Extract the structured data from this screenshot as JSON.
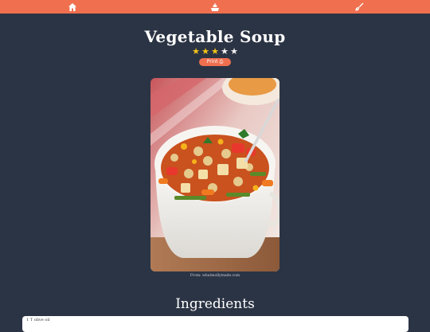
{
  "nav": {
    "items": [
      {
        "icon": "home-icon"
      },
      {
        "icon": "recipes-icon"
      },
      {
        "icon": "whisk-icon"
      }
    ],
    "accent": "#ef6f4f"
  },
  "recipe": {
    "title": "Vegetable Soup",
    "rating": 3,
    "rating_max": 5,
    "star_glyph": "★",
    "print_label": "Print ⎙",
    "image_credit": "From: whatmollymade.com"
  },
  "ingredients": {
    "heading": "Ingredients",
    "items": [
      "1 T olive oil"
    ]
  },
  "colors": {
    "background": "#2b3444",
    "star_filled": "#f5c518",
    "star_empty": "#f2f2f2"
  }
}
